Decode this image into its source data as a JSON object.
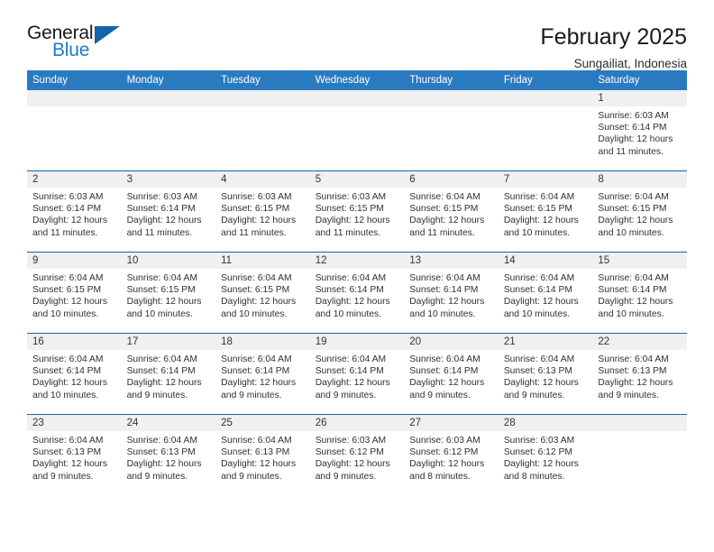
{
  "brand": {
    "name_top": "General",
    "name_bottom": "Blue",
    "logo_icon": "triangle-logo-icon",
    "accent_color": "#1e7bc4"
  },
  "header": {
    "title": "February 2025",
    "subtitle": "Sungailiat, Indonesia"
  },
  "colors": {
    "header_blue": "#2a7ac0",
    "row_divider_blue": "#1464ab",
    "daynum_band": "#f0f0f0",
    "text": "#303030"
  },
  "weekdays": [
    "Sunday",
    "Monday",
    "Tuesday",
    "Wednesday",
    "Thursday",
    "Friday",
    "Saturday"
  ],
  "weeks": [
    [
      {
        "day": "",
        "lines": []
      },
      {
        "day": "",
        "lines": []
      },
      {
        "day": "",
        "lines": []
      },
      {
        "day": "",
        "lines": []
      },
      {
        "day": "",
        "lines": []
      },
      {
        "day": "",
        "lines": []
      },
      {
        "day": "1",
        "lines": [
          "Sunrise: 6:03 AM",
          "Sunset: 6:14 PM",
          "Daylight: 12 hours and 11 minutes."
        ]
      }
    ],
    [
      {
        "day": "2",
        "lines": [
          "Sunrise: 6:03 AM",
          "Sunset: 6:14 PM",
          "Daylight: 12 hours and 11 minutes."
        ]
      },
      {
        "day": "3",
        "lines": [
          "Sunrise: 6:03 AM",
          "Sunset: 6:14 PM",
          "Daylight: 12 hours and 11 minutes."
        ]
      },
      {
        "day": "4",
        "lines": [
          "Sunrise: 6:03 AM",
          "Sunset: 6:15 PM",
          "Daylight: 12 hours and 11 minutes."
        ]
      },
      {
        "day": "5",
        "lines": [
          "Sunrise: 6:03 AM",
          "Sunset: 6:15 PM",
          "Daylight: 12 hours and 11 minutes."
        ]
      },
      {
        "day": "6",
        "lines": [
          "Sunrise: 6:04 AM",
          "Sunset: 6:15 PM",
          "Daylight: 12 hours and 11 minutes."
        ]
      },
      {
        "day": "7",
        "lines": [
          "Sunrise: 6:04 AM",
          "Sunset: 6:15 PM",
          "Daylight: 12 hours and 10 minutes."
        ]
      },
      {
        "day": "8",
        "lines": [
          "Sunrise: 6:04 AM",
          "Sunset: 6:15 PM",
          "Daylight: 12 hours and 10 minutes."
        ]
      }
    ],
    [
      {
        "day": "9",
        "lines": [
          "Sunrise: 6:04 AM",
          "Sunset: 6:15 PM",
          "Daylight: 12 hours and 10 minutes."
        ]
      },
      {
        "day": "10",
        "lines": [
          "Sunrise: 6:04 AM",
          "Sunset: 6:15 PM",
          "Daylight: 12 hours and 10 minutes."
        ]
      },
      {
        "day": "11",
        "lines": [
          "Sunrise: 6:04 AM",
          "Sunset: 6:15 PM",
          "Daylight: 12 hours and 10 minutes."
        ]
      },
      {
        "day": "12",
        "lines": [
          "Sunrise: 6:04 AM",
          "Sunset: 6:14 PM",
          "Daylight: 12 hours and 10 minutes."
        ]
      },
      {
        "day": "13",
        "lines": [
          "Sunrise: 6:04 AM",
          "Sunset: 6:14 PM",
          "Daylight: 12 hours and 10 minutes."
        ]
      },
      {
        "day": "14",
        "lines": [
          "Sunrise: 6:04 AM",
          "Sunset: 6:14 PM",
          "Daylight: 12 hours and 10 minutes."
        ]
      },
      {
        "day": "15",
        "lines": [
          "Sunrise: 6:04 AM",
          "Sunset: 6:14 PM",
          "Daylight: 12 hours and 10 minutes."
        ]
      }
    ],
    [
      {
        "day": "16",
        "lines": [
          "Sunrise: 6:04 AM",
          "Sunset: 6:14 PM",
          "Daylight: 12 hours and 10 minutes."
        ]
      },
      {
        "day": "17",
        "lines": [
          "Sunrise: 6:04 AM",
          "Sunset: 6:14 PM",
          "Daylight: 12 hours and 9 minutes."
        ]
      },
      {
        "day": "18",
        "lines": [
          "Sunrise: 6:04 AM",
          "Sunset: 6:14 PM",
          "Daylight: 12 hours and 9 minutes."
        ]
      },
      {
        "day": "19",
        "lines": [
          "Sunrise: 6:04 AM",
          "Sunset: 6:14 PM",
          "Daylight: 12 hours and 9 minutes."
        ]
      },
      {
        "day": "20",
        "lines": [
          "Sunrise: 6:04 AM",
          "Sunset: 6:14 PM",
          "Daylight: 12 hours and 9 minutes."
        ]
      },
      {
        "day": "21",
        "lines": [
          "Sunrise: 6:04 AM",
          "Sunset: 6:13 PM",
          "Daylight: 12 hours and 9 minutes."
        ]
      },
      {
        "day": "22",
        "lines": [
          "Sunrise: 6:04 AM",
          "Sunset: 6:13 PM",
          "Daylight: 12 hours and 9 minutes."
        ]
      }
    ],
    [
      {
        "day": "23",
        "lines": [
          "Sunrise: 6:04 AM",
          "Sunset: 6:13 PM",
          "Daylight: 12 hours and 9 minutes."
        ]
      },
      {
        "day": "24",
        "lines": [
          "Sunrise: 6:04 AM",
          "Sunset: 6:13 PM",
          "Daylight: 12 hours and 9 minutes."
        ]
      },
      {
        "day": "25",
        "lines": [
          "Sunrise: 6:04 AM",
          "Sunset: 6:13 PM",
          "Daylight: 12 hours and 9 minutes."
        ]
      },
      {
        "day": "26",
        "lines": [
          "Sunrise: 6:03 AM",
          "Sunset: 6:12 PM",
          "Daylight: 12 hours and 9 minutes."
        ]
      },
      {
        "day": "27",
        "lines": [
          "Sunrise: 6:03 AM",
          "Sunset: 6:12 PM",
          "Daylight: 12 hours and 8 minutes."
        ]
      },
      {
        "day": "28",
        "lines": [
          "Sunrise: 6:03 AM",
          "Sunset: 6:12 PM",
          "Daylight: 12 hours and 8 minutes."
        ]
      },
      {
        "day": "",
        "lines": []
      }
    ]
  ]
}
